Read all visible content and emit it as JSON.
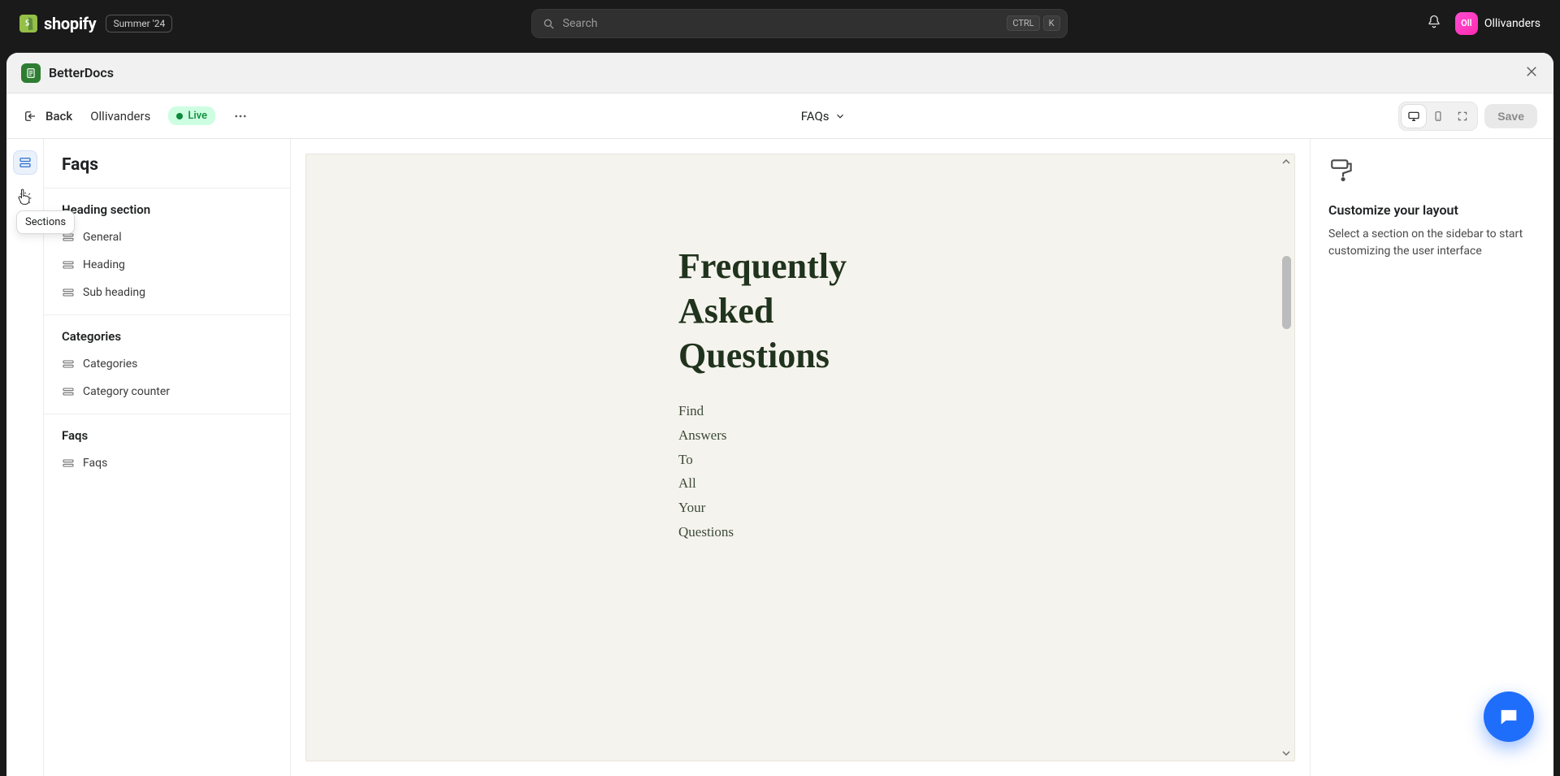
{
  "topbar": {
    "brand": "shopify",
    "badge": "Summer '24",
    "search_placeholder": "Search",
    "kbd1": "CTRL",
    "kbd2": "K",
    "user_name": "Ollivanders",
    "avatar_initials": "Oll"
  },
  "window": {
    "app_name": "BetterDocs"
  },
  "editor": {
    "back_label": "Back",
    "store_name": "Ollivanders",
    "status_label": "Live",
    "page_title": "FAQs",
    "save_label": "Save"
  },
  "rail": {
    "tooltip": "Sections"
  },
  "left_panel": {
    "title": "Faqs",
    "groups": [
      {
        "title": "Heading section",
        "items": [
          "General",
          "Heading",
          "Sub heading"
        ]
      },
      {
        "title": "Categories",
        "items": [
          "Categories",
          "Category counter"
        ]
      },
      {
        "title": "Faqs",
        "items": [
          "Faqs"
        ]
      }
    ]
  },
  "preview": {
    "heading_lines": [
      "Frequently",
      "Asked",
      "Questions"
    ],
    "sub_lines": [
      "Find",
      "Answers",
      "To",
      "All",
      "Your",
      "Questions"
    ]
  },
  "right_panel": {
    "title": "Customize your layout",
    "subtitle": "Select a section on the sidebar to start customizing the user interface"
  }
}
